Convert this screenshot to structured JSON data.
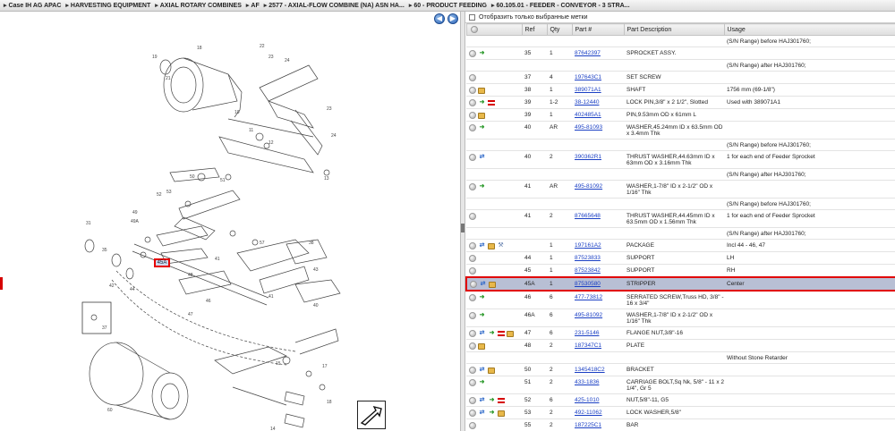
{
  "breadcrumb": [
    "Case IH AG APAC",
    "HARVESTING EQUIPMENT",
    "AXIAL ROTARY COMBINES",
    "AF",
    "2577 - AXIAL-FLOW COMBINE (NA) ASN HA...",
    "60 - PRODUCT FEEDING",
    "60.105.01 - FEEDER - CONVEYOR - 3 STRA..."
  ],
  "nav": {
    "back": "◀",
    "forward": "▶"
  },
  "diagram": {
    "selected_callout": "45A"
  },
  "filter": {
    "label": "Отобразить только выбранные метки"
  },
  "columns": {
    "ref": "Ref",
    "qty": "Qty",
    "part": "Part #",
    "desc": "Part Description",
    "usage": "Usage"
  },
  "rows": [
    {
      "icons": [],
      "ref": "",
      "qty": "",
      "part": "",
      "desc": "",
      "usage": "(S/N Range) before HAJ301760;"
    },
    {
      "icons": [
        "dot",
        "go"
      ],
      "ref": "35",
      "qty": "1",
      "part": "87642397",
      "desc": "SPROCKET ASSY.",
      "usage": ""
    },
    {
      "icons": [],
      "ref": "",
      "qty": "",
      "part": "",
      "desc": "",
      "usage": "(S/N Range) after HAJ301760;"
    },
    {
      "icons": [
        "dot"
      ],
      "ref": "37",
      "qty": "4",
      "part": "197643C1",
      "desc": "SET SCREW",
      "usage": ""
    },
    {
      "icons": [
        "dot",
        "box"
      ],
      "ref": "38",
      "qty": "1",
      "part": "389071A1",
      "desc": "SHAFT",
      "usage": "1756 mm (69-1/8\")"
    },
    {
      "icons": [
        "dot",
        "go",
        "note"
      ],
      "ref": "39",
      "qty": "1-2",
      "part": "38-12440",
      "desc": "LOCK PIN,3/8\" x 2 1/2\", Slotted",
      "usage": "Used with 389071A1"
    },
    {
      "icons": [
        "dot",
        "box"
      ],
      "ref": "39",
      "qty": "1",
      "part": "402485A1",
      "desc": "PIN,9.53mm OD x 61mm L",
      "usage": ""
    },
    {
      "icons": [
        "dot",
        "go"
      ],
      "ref": "40",
      "qty": "AR",
      "part": "495-81093",
      "desc": "WASHER,45.24mm ID x 63.5mm OD x 3.4mm Thk",
      "usage": ""
    },
    {
      "icons": [],
      "ref": "",
      "qty": "",
      "part": "",
      "desc": "",
      "usage": "(S/N Range) before HAJ301760;"
    },
    {
      "icons": [
        "dot",
        "swap"
      ],
      "ref": "40",
      "qty": "2",
      "part": "390362R1",
      "desc": "THRUST WASHER,44.63mm ID x 63mm OD x 3.16mm Thk",
      "usage": "1 for each end of Feeder Sprocket"
    },
    {
      "icons": [],
      "ref": "",
      "qty": "",
      "part": "",
      "desc": "",
      "usage": "(S/N Range) after HAJ301760;"
    },
    {
      "icons": [
        "dot",
        "go"
      ],
      "ref": "41",
      "qty": "AR",
      "part": "495-81092",
      "desc": "WASHER,1-7/8\" ID x 2-1/2\" OD x 1/16\" Thk",
      "usage": ""
    },
    {
      "icons": [],
      "ref": "",
      "qty": "",
      "part": "",
      "desc": "",
      "usage": "(S/N Range) before HAJ301760;"
    },
    {
      "icons": [
        "dot"
      ],
      "ref": "41",
      "qty": "2",
      "part": "87665648",
      "desc": "THRUST WASHER,44.45mm ID x 63.5mm OD x 1.56mm Thk",
      "usage": "1 for each end of Feeder Sprocket"
    },
    {
      "icons": [],
      "ref": "",
      "qty": "",
      "part": "",
      "desc": "",
      "usage": "(S/N Range) after HAJ301760;"
    },
    {
      "icons": [
        "dot",
        "swap",
        "box",
        "wrench"
      ],
      "ref": "",
      "qty": "1",
      "part": "197161A2",
      "desc": "PACKAGE",
      "usage": "Incl 44 - 46, 47"
    },
    {
      "icons": [
        "dot"
      ],
      "ref": "44",
      "qty": "1",
      "part": "87523833",
      "desc": "SUPPORT",
      "usage": "LH"
    },
    {
      "icons": [
        "dot"
      ],
      "ref": "45",
      "qty": "1",
      "part": "87523842",
      "desc": "SUPPORT",
      "usage": "RH"
    },
    {
      "icons": [
        "dot",
        "swap",
        "box"
      ],
      "ref": "45A",
      "qty": "1",
      "part": "87530580",
      "desc": "STRIPPER",
      "usage": "Center",
      "selected": true
    },
    {
      "icons": [
        "dot",
        "go"
      ],
      "ref": "46",
      "qty": "6",
      "part": "477-73812",
      "desc": "SERRATED SCREW,Truss HD, 3/8\" - 16 x 3/4\"",
      "usage": ""
    },
    {
      "icons": [
        "dot",
        "go"
      ],
      "ref": "46A",
      "qty": "6",
      "part": "495-81092",
      "desc": "WASHER,1-7/8\" ID x 2-1/2\" OD x 1/16\" Thk",
      "usage": ""
    },
    {
      "icons": [
        "dot",
        "swap",
        "go",
        "note",
        "box"
      ],
      "ref": "47",
      "qty": "6",
      "part": "231-5146",
      "desc": "FLANGE NUT,3/8\"-16",
      "usage": ""
    },
    {
      "icons": [
        "dot",
        "box"
      ],
      "ref": "48",
      "qty": "2",
      "part": "187347C1",
      "desc": "PLATE",
      "usage": ""
    },
    {
      "icons": [],
      "ref": "",
      "qty": "",
      "part": "",
      "desc": "",
      "usage": "Without Stone Retarder"
    },
    {
      "icons": [
        "dot",
        "swap",
        "box"
      ],
      "ref": "50",
      "qty": "2",
      "part": "1345418C2",
      "desc": "BRACKET",
      "usage": ""
    },
    {
      "icons": [
        "dot",
        "go"
      ],
      "ref": "51",
      "qty": "2",
      "part": "433-1836",
      "desc": "CARRIAGE BOLT,Sq Nk, 5/8\" - 11 x 2 1/4\", Gr 5",
      "usage": ""
    },
    {
      "icons": [
        "dot",
        "swap",
        "go",
        "note"
      ],
      "ref": "52",
      "qty": "6",
      "part": "425-1010",
      "desc": "NUT,5/8\"-11, G5",
      "usage": ""
    },
    {
      "icons": [
        "dot",
        "swap",
        "go",
        "box"
      ],
      "ref": "53",
      "qty": "2",
      "part": "492-11062",
      "desc": "LOCK WASHER,5/8\"",
      "usage": ""
    },
    {
      "icons": [
        "dot"
      ],
      "ref": "55",
      "qty": "2",
      "part": "187225C1",
      "desc": "BAR",
      "usage": ""
    }
  ],
  "icon_names": {
    "dot": "status-dot-icon",
    "go": "green-arrow-icon",
    "swap": "blue-swap-icon",
    "box": "package-icon",
    "note": "note-icon",
    "wrench": "wrench-icon"
  }
}
